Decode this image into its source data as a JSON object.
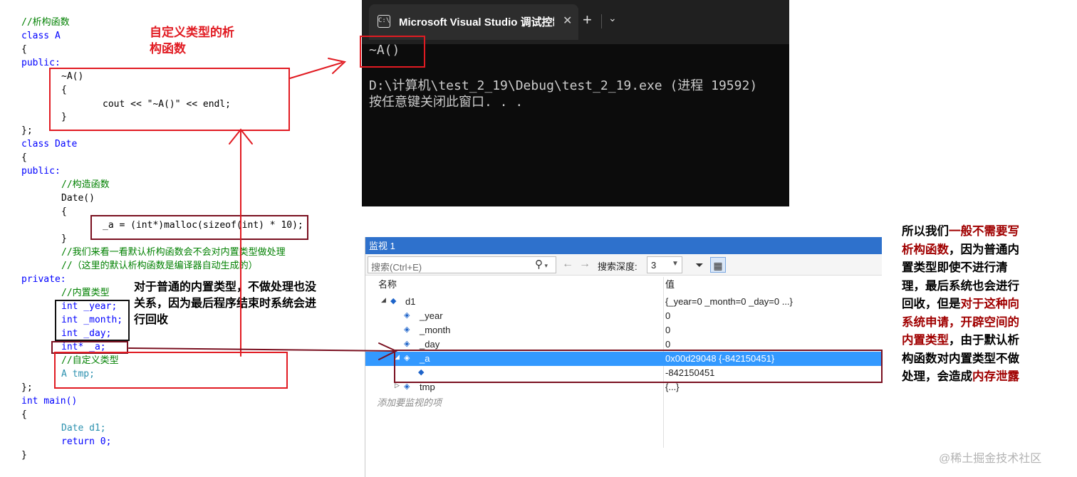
{
  "code": {
    "lines": [
      "//析构函数",
      "class A",
      "{",
      "public:",
      "~A()",
      "{",
      "cout << \"~A()\" << endl;",
      "}",
      "};",
      "class Date",
      "{",
      "public:",
      "//构造函数",
      "Date()",
      "{",
      "_a = (int*)malloc(sizeof(int) * 10);",
      "}",
      "//我们来看一看默认析构函数会不会对内置类型做处理",
      "//（这里的默认析构函数是编译器自动生成的）",
      "private:",
      "//内置类型",
      "int _year;",
      "int _month;",
      "int _day;",
      "int* _a;",
      "//自定义类型",
      "A tmp;",
      "};",
      "int main()",
      "{",
      "Date d1;",
      "return 0;",
      "}"
    ]
  },
  "annotations": {
    "custom_type_dtor": [
      "自定义类型的析",
      "构函数"
    ],
    "builtin_note": [
      "对于普通的内置类型，不做处理也没",
      "关系，因为最后程序结束时系统会进",
      "行回收"
    ],
    "right_note": [
      [
        {
          "t": "所以我们",
          "r": false
        },
        {
          "t": "一般不需要写",
          "r": true
        }
      ],
      [
        {
          "t": "析构函数",
          "r": true
        },
        {
          "t": "，因为普通内",
          "r": false
        }
      ],
      [
        {
          "t": "置类型即使不进行清",
          "r": false
        }
      ],
      [
        {
          "t": "理，最后系统也会进行",
          "r": false
        }
      ],
      [
        {
          "t": "回收，但是",
          "r": false
        },
        {
          "t": "对于这种向",
          "r": true
        }
      ],
      [
        {
          "t": "系统申请，开辟空间的",
          "r": true
        }
      ],
      [
        {
          "t": "内置类型",
          "r": true
        },
        {
          "t": "，由于默认析",
          "r": false
        }
      ],
      [
        {
          "t": "构函数对内置类型不做",
          "r": false
        }
      ],
      [
        {
          "t": "处理，会造成",
          "r": false
        },
        {
          "t": "内存泄露",
          "r": true
        }
      ]
    ]
  },
  "console": {
    "tab_title": "Microsoft Visual Studio 调试控制台",
    "tab_icon": "terminal-icon",
    "close_label": "✕",
    "new_tab_label": "+",
    "dropdown_label": "⌄",
    "output_line1": "~A()",
    "output_line2": "D:\\计算机\\test_2_19\\Debug\\test_2_19.exe (进程 19592)",
    "output_line3": "按任意键关闭此窗口. . ."
  },
  "watch": {
    "title": "监视 1",
    "search_placeholder": "搜索(Ctrl+E)",
    "search_icon": "search-icon",
    "depth_label": "搜索深度:",
    "depth_value": "3",
    "col_name": "名称",
    "col_value": "值",
    "rows": [
      {
        "name": "d1",
        "value": "{_year=0 _month=0 _day=0 ...}"
      },
      {
        "name": "_year",
        "value": "0"
      },
      {
        "name": "_month",
        "value": "0"
      },
      {
        "name": "_day",
        "value": "0"
      },
      {
        "name": "_a",
        "value": "0x00d29048 {-842150451}"
      },
      {
        "name": "",
        "value": "-842150451"
      },
      {
        "name": "tmp",
        "value": "{...}"
      }
    ],
    "add_item": "添加要监视的项"
  },
  "watermark": "@稀土掘金技术社区",
  "colors": {
    "annotation_red": "#e11b22",
    "dark_red": "#7a1020",
    "vs_blue": "#2e71cc"
  }
}
